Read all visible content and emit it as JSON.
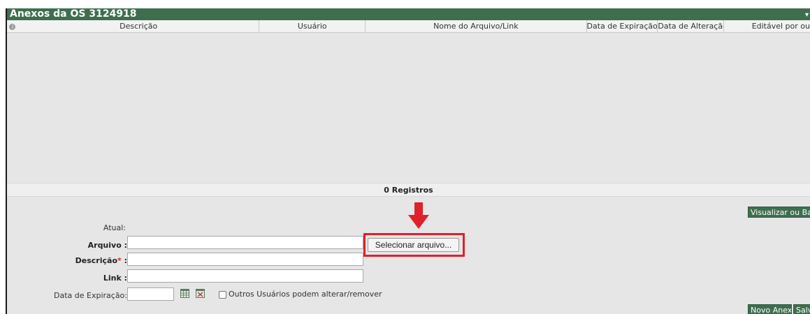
{
  "panel": {
    "title": "Anexos da OS 3124918"
  },
  "grid": {
    "columns": [
      "Descrição",
      "Usuário",
      "Nome do Arquivo/Link",
      "Data de Expiração",
      "Data de Alteração",
      "Editável por ou"
    ],
    "records_label": "0 Registros"
  },
  "form": {
    "atual_label": "Atual:",
    "arquivo_label": "Arquivo :",
    "descricao_label": "Descrição",
    "descricao_required_mark": "*",
    "descricao_colon": " :",
    "link_label": "Link :",
    "data_expiracao_label": "Data de Expiração:",
    "arquivo_value": "",
    "descricao_value": "",
    "link_value": "",
    "data_expiracao_value": "",
    "select_file_label": "Selecionar arquivo...",
    "outros_usuarios_label": "Outros Usuários podem alterar/remover",
    "outros_usuarios_checked": false
  },
  "actions": {
    "view_download_label": "Visualizar ou Baixa",
    "new_attachment_label": "Novo Anexo",
    "save_label": "Salva"
  },
  "colors": {
    "header_green": "#3f6e4f",
    "highlight_red": "#e0202a"
  },
  "icons": [
    "info-icon",
    "calendar-icon",
    "calendar-clear-icon",
    "down-arrow-icon"
  ]
}
